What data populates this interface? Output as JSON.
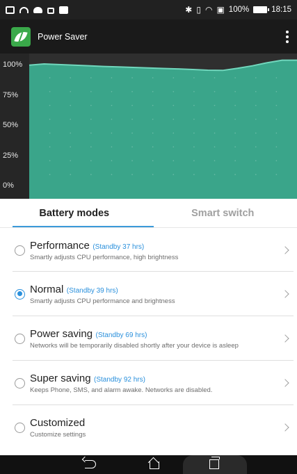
{
  "status_bar": {
    "battery_percent": "100%",
    "time": "18:15"
  },
  "app": {
    "title": "Power Saver"
  },
  "chart": {
    "y_labels": [
      "100%",
      "75%",
      "50%",
      "25%",
      "0%"
    ],
    "fill_color": "#3aa58a",
    "line_color": "#71d7bd"
  },
  "chart_data": {
    "type": "area",
    "title": "",
    "xlabel": "",
    "ylabel": "",
    "ylim": [
      0,
      100
    ],
    "y_ticks": [
      "100%",
      "75%",
      "50%",
      "25%",
      "0%"
    ],
    "x": [
      0,
      1,
      2,
      3,
      4,
      5,
      6,
      7,
      8,
      9,
      10,
      11,
      12,
      13,
      14,
      15,
      16,
      17,
      18
    ],
    "values": [
      99,
      100,
      99.5,
      99,
      98.5,
      98,
      97.6,
      97.2,
      96.8,
      96.4,
      96,
      95.5,
      95,
      94.8,
      96.5,
      98.5,
      101,
      103,
      103
    ],
    "grid": true
  },
  "tabs": [
    {
      "label": "Battery modes",
      "active": true
    },
    {
      "label": "Smart switch",
      "active": false
    }
  ],
  "modes": [
    {
      "title": "Performance",
      "standby": "(Standby 37 hrs)",
      "desc": "Smartly adjusts CPU performance, high brightness",
      "selected": false
    },
    {
      "title": "Normal",
      "standby": "(Standby 39 hrs)",
      "desc": "Smartly adjusts CPU performance and brightness",
      "selected": true
    },
    {
      "title": "Power saving",
      "standby": "(Standby 69 hrs)",
      "desc": "Networks will be temporarily disabled shortly after your device is asleep",
      "selected": false
    },
    {
      "title": "Super saving",
      "standby": "(Standby 92 hrs)",
      "desc": "Keeps Phone, SMS, and alarm awake. Networks are disabled.",
      "selected": false
    },
    {
      "title": "Customized",
      "standby": "",
      "desc": "Customize settings",
      "selected": false
    }
  ]
}
